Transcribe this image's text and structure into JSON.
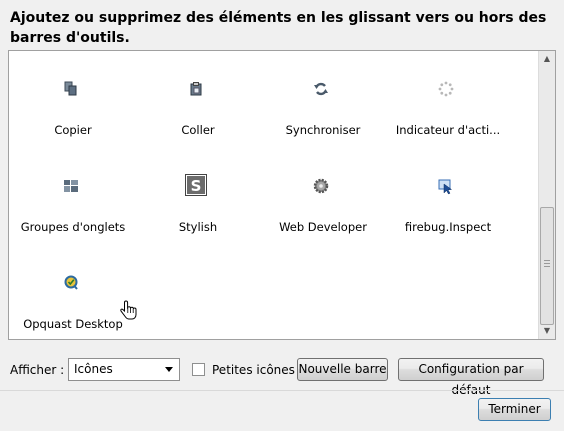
{
  "heading": "Ajoutez ou supprimez des éléments en les glissant vers ou hors des barres d'outils.",
  "items": [
    {
      "label": "Copier",
      "icon": "copy-icon"
    },
    {
      "label": "Coller",
      "icon": "paste-icon"
    },
    {
      "label": "Synchroniser",
      "icon": "sync-icon"
    },
    {
      "label": "Indicateur d'acti...",
      "icon": "activity-indicator-icon"
    },
    {
      "label": "Groupes d'onglets",
      "icon": "tab-groups-icon"
    },
    {
      "label": "Stylish",
      "icon": "stylish-icon"
    },
    {
      "label": "Web Developer",
      "icon": "web-developer-gear-icon"
    },
    {
      "label": "firebug.Inspect",
      "icon": "firebug-inspect-icon"
    },
    {
      "label": "Opquast Desktop",
      "icon": "opquast-desktop-icon"
    }
  ],
  "footer": {
    "show_label": "Afficher :",
    "show_value": "Icônes",
    "small_icons_label": "Petites icônes",
    "new_toolbar_label": "Nouvelle barre",
    "default_config_label": "Configuration par défaut",
    "done_label": "Terminer"
  },
  "colors": {
    "panel_bg": "#ffffff",
    "window_bg": "#f0f0f0",
    "border": "#a0a0a0"
  }
}
